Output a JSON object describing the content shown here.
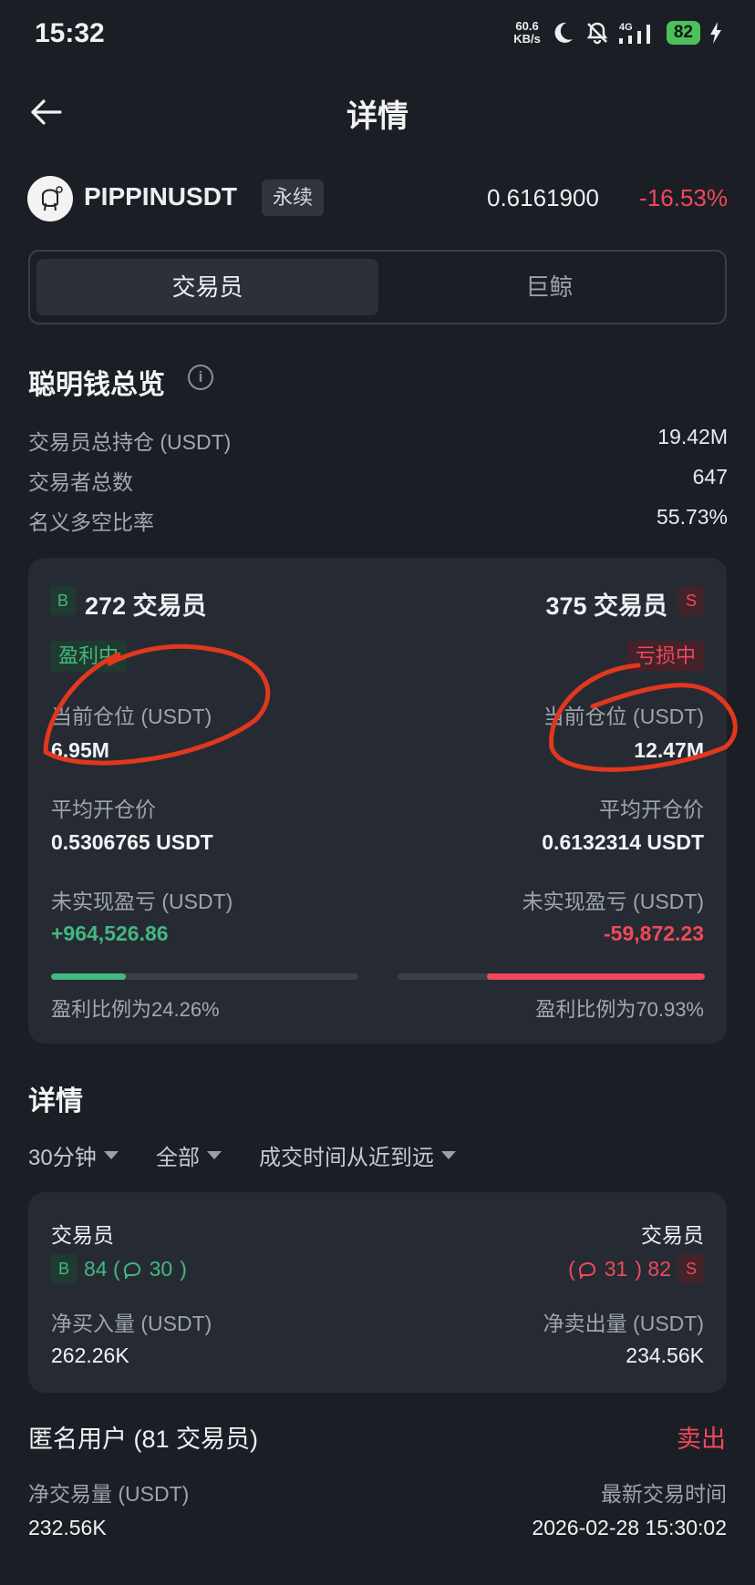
{
  "status_bar": {
    "time": "15:32",
    "net_speed_value": "60.6",
    "net_speed_unit": "KB/s",
    "network": "4G",
    "battery": "82",
    "icons": [
      "moon-icon",
      "bell-off-icon",
      "signal-icon",
      "charging-icon"
    ]
  },
  "header": {
    "title": "详情"
  },
  "token": {
    "name": "PIPPINUSDT",
    "tag": "永续",
    "price": "0.6161900",
    "change": "-16.53%"
  },
  "tabs": [
    {
      "label": "交易员",
      "active": true
    },
    {
      "label": "巨鲸",
      "active": false
    }
  ],
  "overview": {
    "title": "聪明钱总览",
    "rows": [
      {
        "label": "交易员总持仓 (USDT)",
        "value": "19.42M"
      },
      {
        "label": "交易者总数",
        "value": "647"
      },
      {
        "label": "名义多空比率",
        "value": "55.73%"
      }
    ]
  },
  "summary_card": {
    "long": {
      "badge": "B",
      "traders": "272 交易员",
      "status": "盈利中",
      "position_label": "当前仓位 (USDT)",
      "position_value": "6.95M",
      "avg_label": "平均开仓价",
      "avg_value": "0.5306765 USDT",
      "pnl_label": "未实现盈亏 (USDT)",
      "pnl_value": "+964,526.86",
      "ratio_text": "盈利比例为24.26%",
      "ratio": 0.2426
    },
    "short": {
      "badge": "S",
      "traders": "375 交易员",
      "status": "亏损中",
      "position_label": "当前仓位 (USDT)",
      "position_value": "12.47M",
      "avg_label": "平均开仓价",
      "avg_value": "0.6132314 USDT",
      "pnl_label": "未实现盈亏 (USDT)",
      "pnl_value": "-59,872.23",
      "ratio_text": "盈利比例为70.93%",
      "ratio": 0.7093
    }
  },
  "details": {
    "title": "详情",
    "filters": [
      "30分钟",
      "全部",
      "成交时间从近到远"
    ],
    "card": {
      "left_title": "交易员",
      "left_badge": "B",
      "left_counts": "84 (",
      "left_sub": "30",
      "left_close": ")",
      "left_metric_label": "净买入量 (USDT)",
      "left_metric_value": "262.26K",
      "right_title": "交易员",
      "right_badge": "S",
      "right_open": "(",
      "right_sub": "31",
      "right_counts": ") 82",
      "right_metric_label": "净卖出量 (USDT)",
      "right_metric_value": "234.56K"
    },
    "anon": {
      "title": "匿名用户 (81 交易员)",
      "action": "卖出",
      "volume_label": "净交易量 (USDT)",
      "volume_value": "232.56K",
      "time_label": "最新交易时间",
      "time_value": "2026-02-28 15:30:02"
    }
  },
  "colors": {
    "background": "#1b1f25",
    "card": "#262b33",
    "green": "#43b780",
    "red": "#f0485a",
    "annotation": "#e2371f"
  }
}
